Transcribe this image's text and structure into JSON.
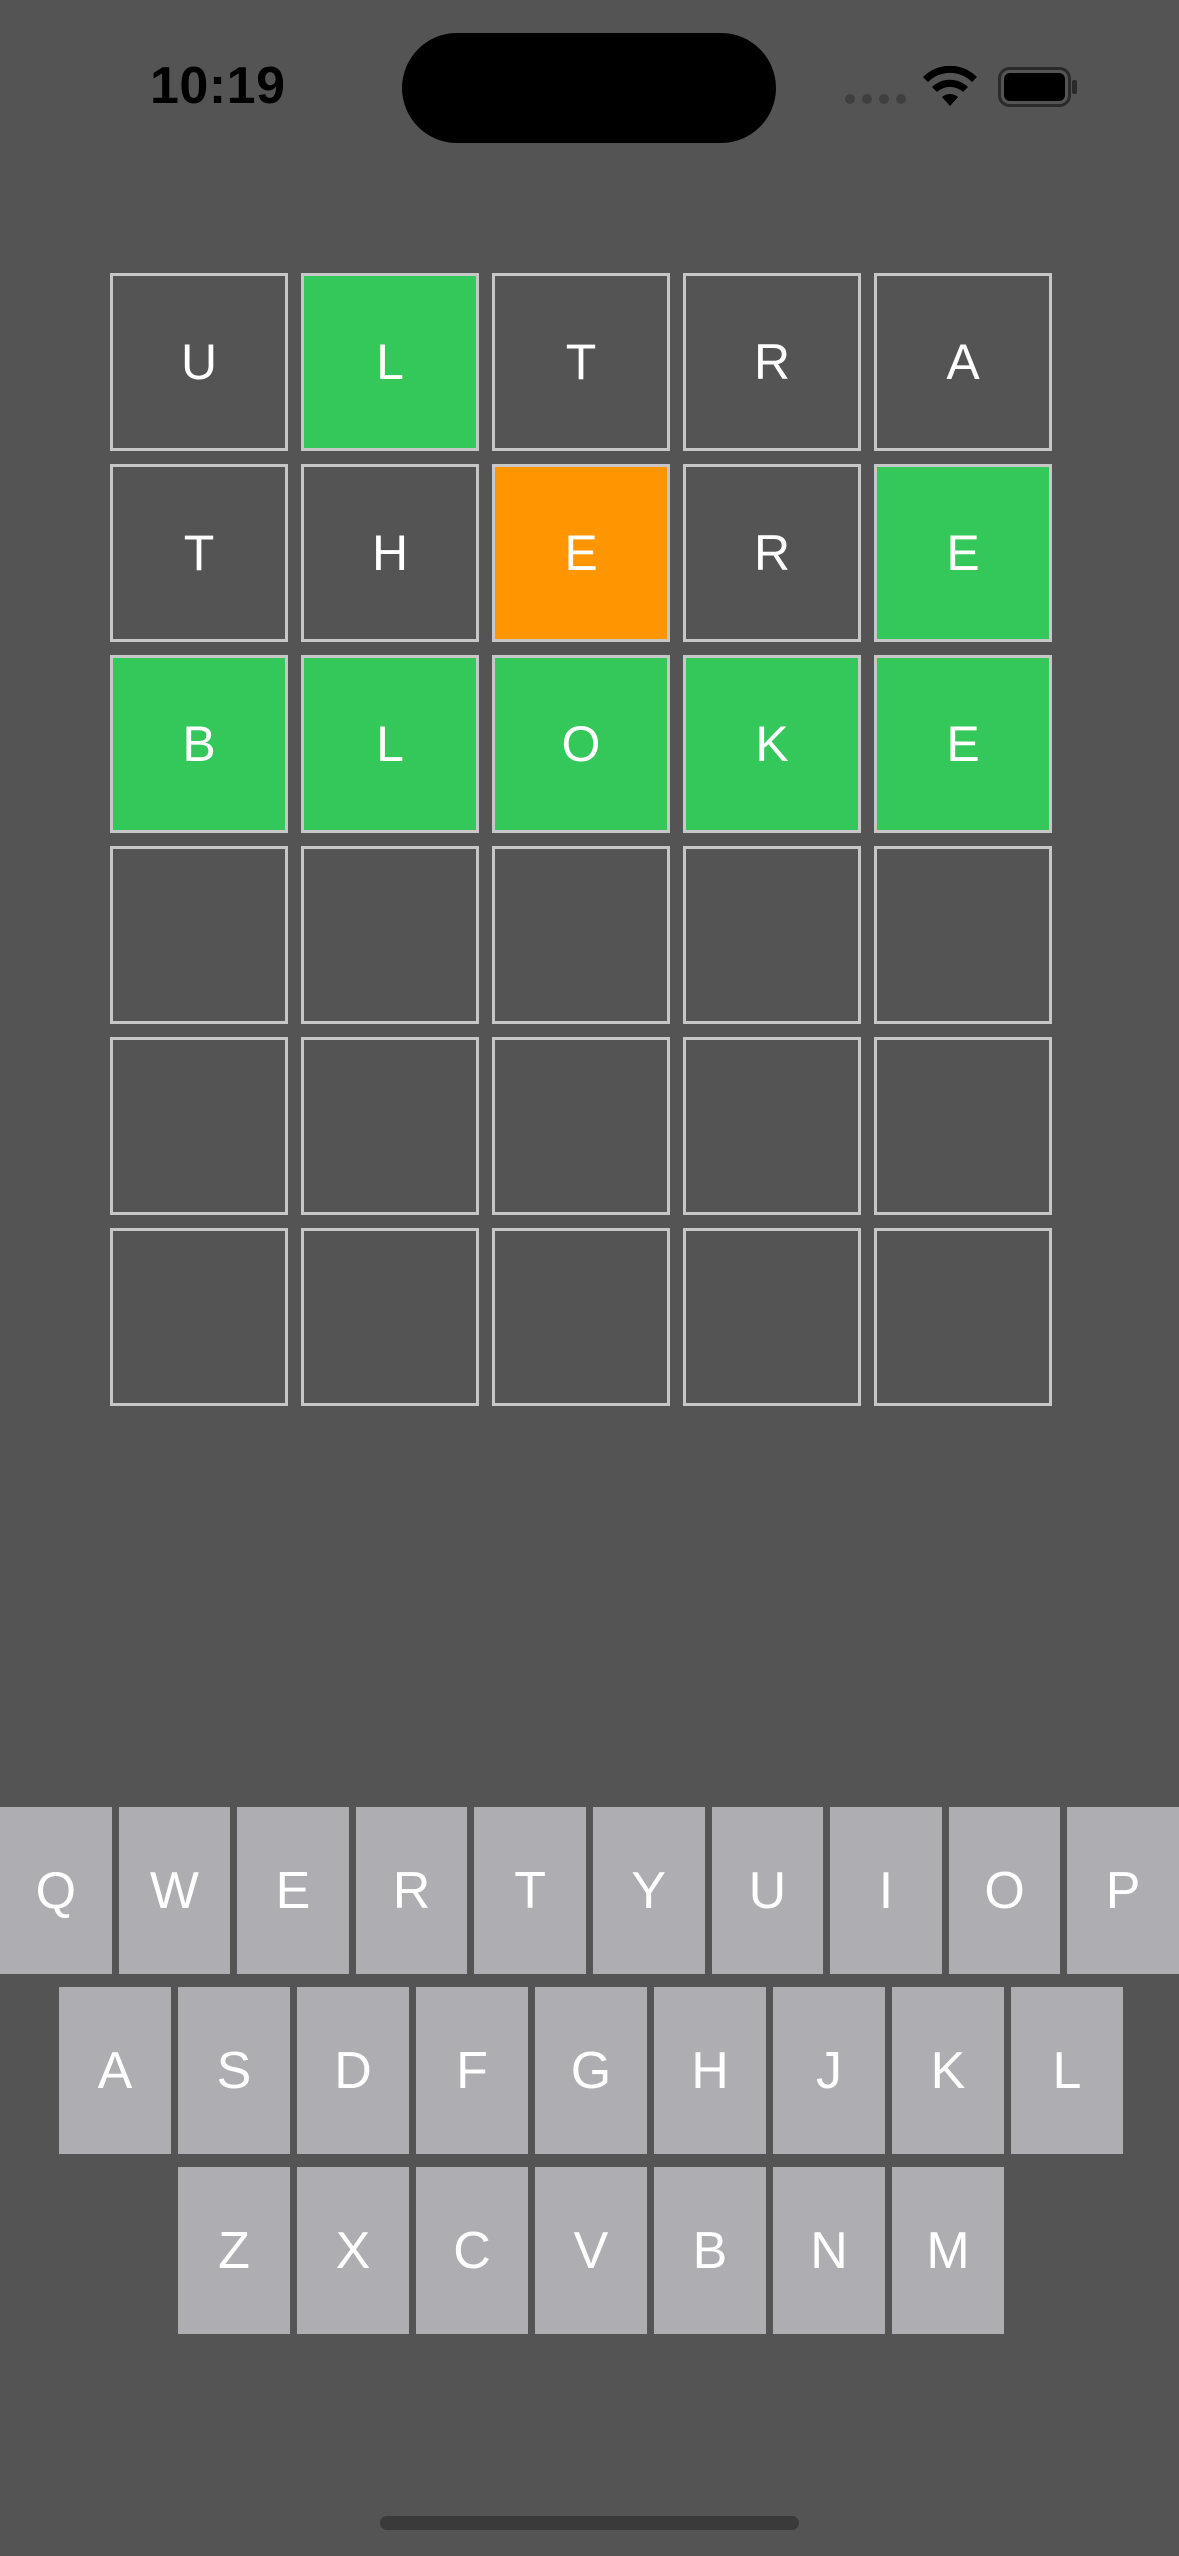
{
  "status_bar": {
    "time": "10:19",
    "icons": [
      "cellular-signal-icon",
      "wifi-icon",
      "battery-icon"
    ]
  },
  "colors": {
    "background": "#545454",
    "correct": "#34c759",
    "present": "#ff9500",
    "key": "#aeaeb2",
    "tile_border": "#c7c7c7"
  },
  "board": {
    "rows": [
      [
        {
          "letter": "U",
          "state": "absent"
        },
        {
          "letter": "L",
          "state": "correct"
        },
        {
          "letter": "T",
          "state": "absent"
        },
        {
          "letter": "R",
          "state": "absent"
        },
        {
          "letter": "A",
          "state": "absent"
        }
      ],
      [
        {
          "letter": "T",
          "state": "absent"
        },
        {
          "letter": "H",
          "state": "absent"
        },
        {
          "letter": "E",
          "state": "present"
        },
        {
          "letter": "R",
          "state": "absent"
        },
        {
          "letter": "E",
          "state": "correct"
        }
      ],
      [
        {
          "letter": "B",
          "state": "correct"
        },
        {
          "letter": "L",
          "state": "correct"
        },
        {
          "letter": "O",
          "state": "correct"
        },
        {
          "letter": "K",
          "state": "correct"
        },
        {
          "letter": "E",
          "state": "correct"
        }
      ],
      [
        {
          "letter": "",
          "state": "empty"
        },
        {
          "letter": "",
          "state": "empty"
        },
        {
          "letter": "",
          "state": "empty"
        },
        {
          "letter": "",
          "state": "empty"
        },
        {
          "letter": "",
          "state": "empty"
        }
      ],
      [
        {
          "letter": "",
          "state": "empty"
        },
        {
          "letter": "",
          "state": "empty"
        },
        {
          "letter": "",
          "state": "empty"
        },
        {
          "letter": "",
          "state": "empty"
        },
        {
          "letter": "",
          "state": "empty"
        }
      ],
      [
        {
          "letter": "",
          "state": "empty"
        },
        {
          "letter": "",
          "state": "empty"
        },
        {
          "letter": "",
          "state": "empty"
        },
        {
          "letter": "",
          "state": "empty"
        },
        {
          "letter": "",
          "state": "empty"
        }
      ]
    ]
  },
  "keyboard": {
    "row1": [
      "Q",
      "W",
      "E",
      "R",
      "T",
      "Y",
      "U",
      "I",
      "O",
      "P"
    ],
    "row2": [
      "A",
      "S",
      "D",
      "F",
      "G",
      "H",
      "J",
      "K",
      "L"
    ],
    "row3": [
      "Z",
      "X",
      "C",
      "V",
      "B",
      "N",
      "M"
    ]
  }
}
